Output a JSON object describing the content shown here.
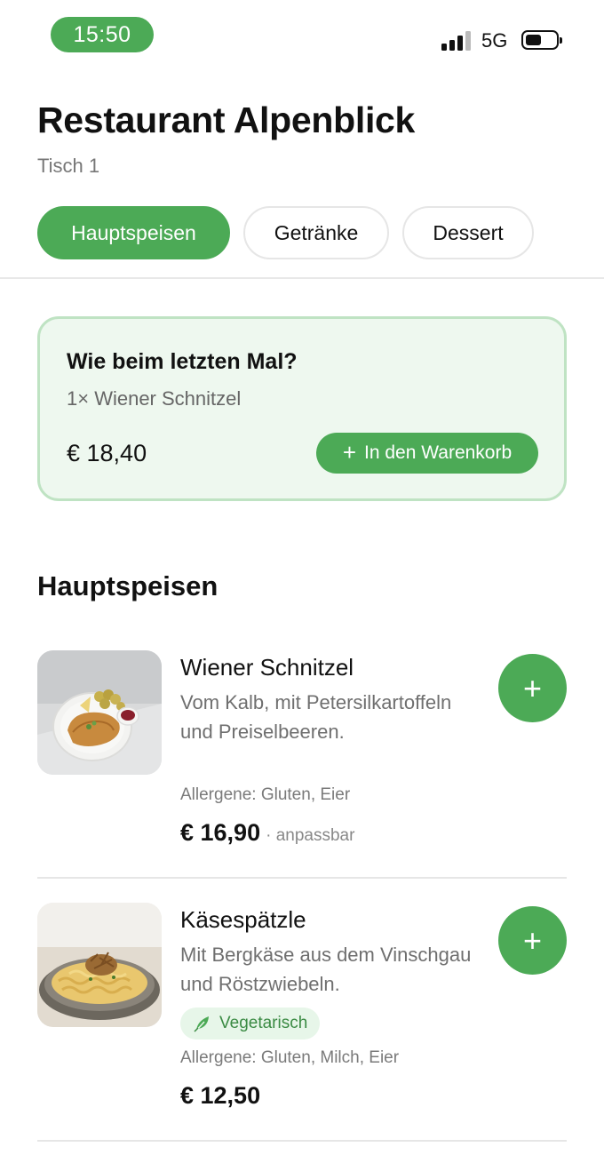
{
  "status_bar": {
    "time": "15:50",
    "network": "5G"
  },
  "header": {
    "title": "Restaurant Alpenblick",
    "table": "Tisch 1"
  },
  "tabs": [
    {
      "label": "Hauptspeisen",
      "active": true
    },
    {
      "label": "Getränke",
      "active": false
    },
    {
      "label": "Dessert",
      "active": false
    }
  ],
  "reorder": {
    "title": "Wie beim letzten Mal?",
    "items": "1× Wiener Schnitzel",
    "price": "€ 18,40",
    "button_icon": "+",
    "button_label": "In den Warenkorb"
  },
  "section": {
    "title": "Hauptspeisen"
  },
  "dishes": [
    {
      "name": "Wiener Schnitzel",
      "description": "Vom Kalb, mit Petersilkartoffeln und Preiselbeeren.",
      "allergens": "Allergene: Gluten, Eier",
      "price": "€ 16,90",
      "note": "· anpassbar",
      "add_icon": "+"
    },
    {
      "name": "Käsespätzle",
      "description": "Mit Bergkäse aus dem Vinschgau und Röstzwiebeln.",
      "badge": "Vegetarisch",
      "allergens": "Allergene: Gluten, Milch, Eier",
      "price": "€ 12,50",
      "add_icon": "+"
    }
  ],
  "colors": {
    "accent": "#4caa56",
    "card_bg": "#eef8ef",
    "card_border": "#bfe3c3",
    "badge_bg": "#e7f6e9"
  }
}
